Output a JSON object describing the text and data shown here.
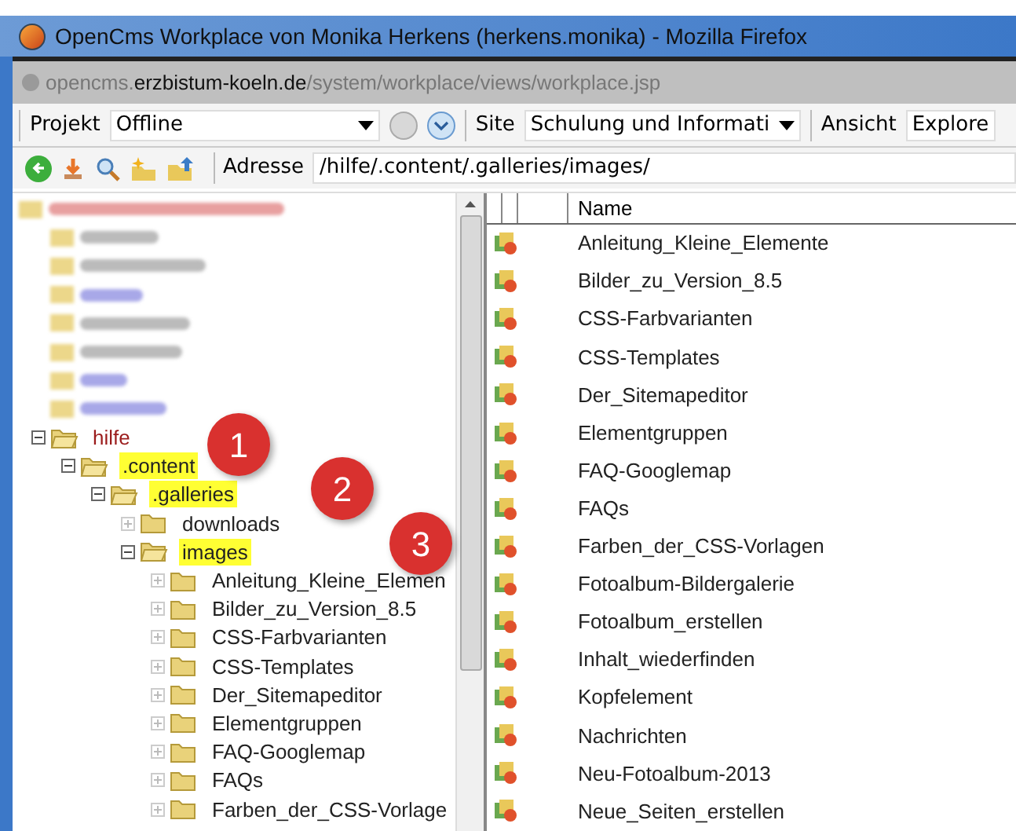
{
  "window": {
    "title": "OpenCms Workplace von Monika Herkens (herkens.monika) - Mozilla Firefox"
  },
  "address_bar": {
    "prefix": "opencms.",
    "domain": "erzbistum-koeln.de",
    "path": "/system/workplace/views/workplace.jsp"
  },
  "toolbar": {
    "project_label": "Projekt",
    "project_value": "Offline",
    "site_label": "Site",
    "site_value": "Schulung und Informati",
    "view_label": "Ansicht",
    "view_value": "Explore"
  },
  "location": {
    "label": "Adresse",
    "value": "/hilfe/.content/.galleries/images/"
  },
  "tree": [
    {
      "label": "hilfe",
      "expanded": true,
      "highlighted": false,
      "children": [
        {
          "label": ".content",
          "expanded": true,
          "highlighted": true,
          "children": [
            {
              "label": ".galleries",
              "expanded": true,
              "highlighted": true,
              "children": [
                {
                  "label": "downloads",
                  "expanded": false,
                  "highlighted": false
                },
                {
                  "label": "images",
                  "expanded": true,
                  "highlighted": true,
                  "children": [
                    {
                      "label": "Anleitung_Kleine_Elemen",
                      "expanded": false,
                      "highlighted": false
                    },
                    {
                      "label": "Bilder_zu_Version_8.5",
                      "expanded": false,
                      "highlighted": false
                    },
                    {
                      "label": "CSS-Farbvarianten",
                      "expanded": false,
                      "highlighted": false
                    },
                    {
                      "label": "CSS-Templates",
                      "expanded": false,
                      "highlighted": false
                    },
                    {
                      "label": "Der_Sitemapeditor",
                      "expanded": false,
                      "highlighted": false
                    },
                    {
                      "label": "Elementgruppen",
                      "expanded": false,
                      "highlighted": false
                    },
                    {
                      "label": "FAQ-Googlemap",
                      "expanded": false,
                      "highlighted": false
                    },
                    {
                      "label": "FAQs",
                      "expanded": false,
                      "highlighted": false
                    },
                    {
                      "label": "Farben_der_CSS-Vorlage",
                      "expanded": false,
                      "highlighted": false
                    }
                  ]
                }
              ]
            }
          ]
        }
      ]
    }
  ],
  "callouts": [
    "1",
    "2",
    "3"
  ],
  "list": {
    "column": "Name",
    "rows": [
      "Anleitung_Kleine_Elemente",
      "Bilder_zu_Version_8.5",
      "CSS-Farbvarianten",
      "CSS-Templates",
      "Der_Sitemapeditor",
      "Elementgruppen",
      "FAQ-Googlemap",
      "FAQs",
      "Farben_der_CSS-Vorlagen",
      "Fotoalbum-Bildergalerie",
      "Fotoalbum_erstellen",
      "Inhalt_wiederfinden",
      "Kopfelement",
      "Nachrichten",
      "Neu-Fotoalbum-2013",
      "Neue_Seiten_erstellen"
    ]
  }
}
